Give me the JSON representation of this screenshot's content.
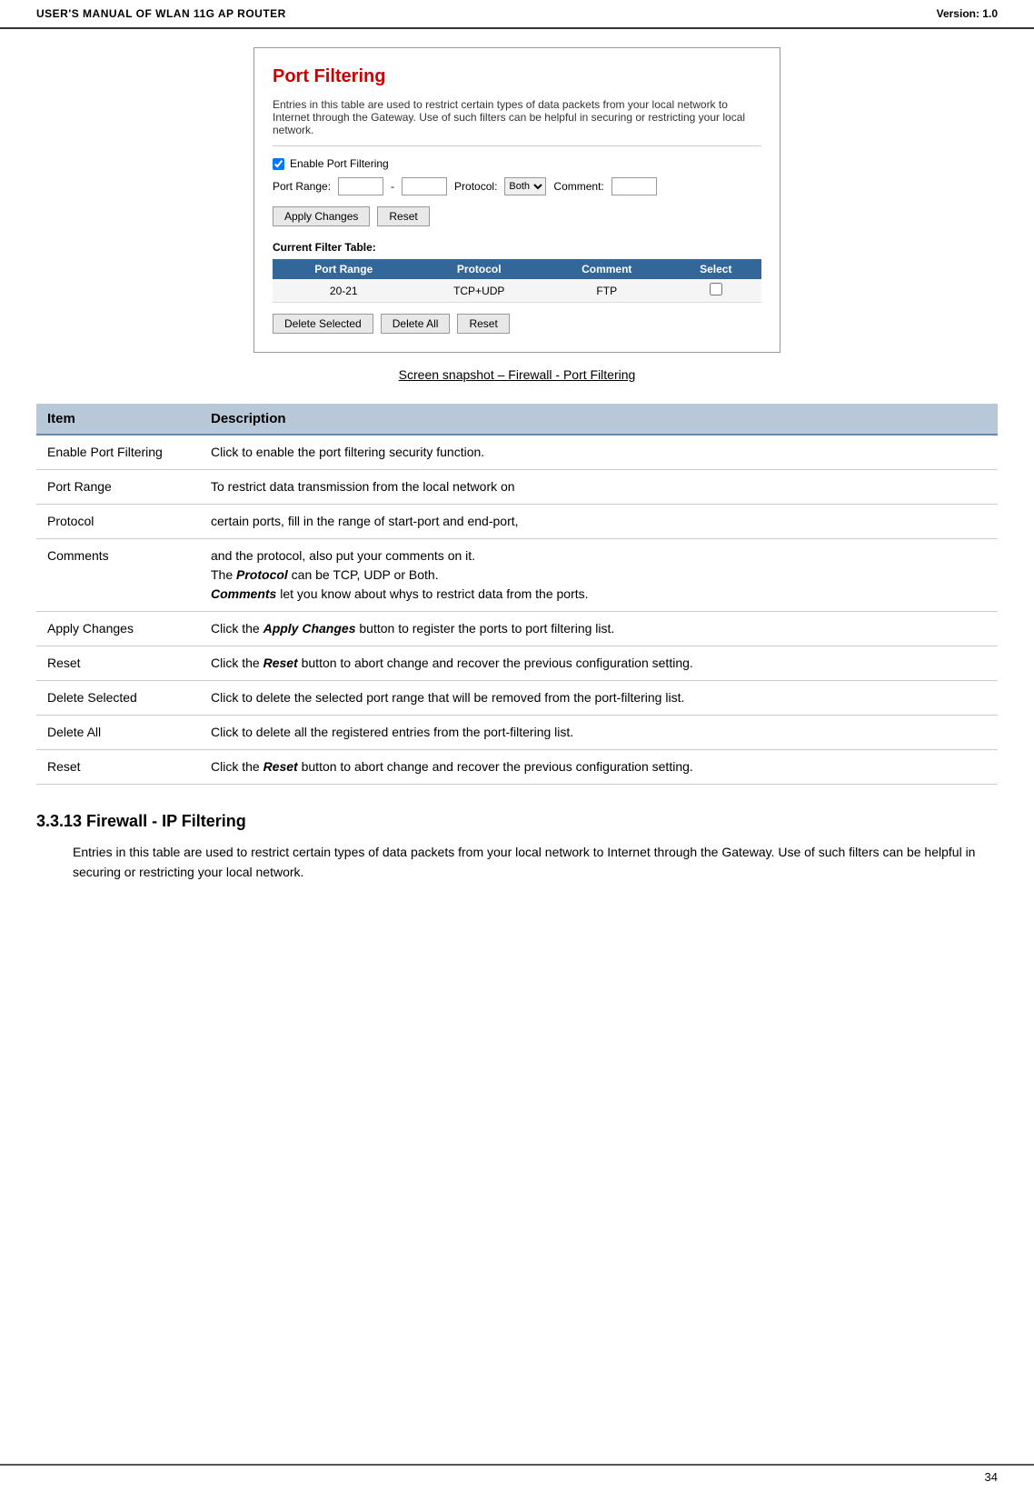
{
  "header": {
    "manual_title": "USER'S MANUAL OF WLAN 11G AP ROUTER",
    "version": "Version: 1.0"
  },
  "screenshot": {
    "title": "Port Filtering",
    "description": "Entries in this table are used to restrict certain types of data packets from your local network to Internet through the Gateway. Use of such filters can be helpful in securing or restricting your local network.",
    "enable_label": "Enable Port Filtering",
    "port_range_label": "Port Range:",
    "port_range_sep": "-",
    "protocol_label": "Protocol:",
    "protocol_value": "Both",
    "comment_label": "Comment:",
    "apply_btn": "Apply Changes",
    "reset_btn": "Reset",
    "current_filter_label": "Current Filter Table:",
    "table_headers": [
      "Port Range",
      "Protocol",
      "Comment",
      "Select"
    ],
    "table_rows": [
      {
        "port_range": "20-21",
        "protocol": "TCP+UDP",
        "comment": "FTP"
      }
    ],
    "delete_selected_btn": "Delete Selected",
    "delete_all_btn": "Delete All",
    "bottom_reset_btn": "Reset"
  },
  "caption": "Screen snapshot – Firewall - Port Filtering",
  "desc_table": {
    "col_item": "Item",
    "col_description": "Description",
    "rows": [
      {
        "item": "Enable Port Filtering",
        "description": "Click to enable the port filtering security function."
      },
      {
        "item": "Port Range",
        "description": "To restrict data transmission from the local network on"
      },
      {
        "item": "Protocol",
        "description": "certain ports, fill in the range of start-port and end-port,"
      },
      {
        "item": "Comments",
        "description_parts": [
          {
            "text": "and the protocol, also put your comments on it.",
            "bold_italic": false
          },
          {
            "text": "The ",
            "bold_italic": false
          },
          {
            "text": "Protocol",
            "bold_italic": true
          },
          {
            "text": " can be TCP, UDP or Both.",
            "bold_italic": false
          }
        ],
        "description_line2_parts": [
          {
            "text": "Comments",
            "bold_italic": true
          },
          {
            "text": " let you know about whys to restrict data from the ports.",
            "bold_italic": false
          }
        ]
      },
      {
        "item": "Apply Changes",
        "description_parts": [
          {
            "text": "Click the ",
            "bold_italic": false
          },
          {
            "text": "Apply Changes",
            "bold_italic": true
          },
          {
            "text": " button to register the ports to port filtering list.",
            "bold_italic": false
          }
        ]
      },
      {
        "item": "Reset",
        "description_parts": [
          {
            "text": "Click the ",
            "bold_italic": false
          },
          {
            "text": "Reset",
            "bold_italic": true
          },
          {
            "text": " button to abort change and recover the previous configuration setting.",
            "bold_italic": false
          }
        ]
      },
      {
        "item": "Delete Selected",
        "description": "Click to delete the selected port range that will be removed from the port-filtering list."
      },
      {
        "item": "Delete All",
        "description": "Click to delete all the registered entries from the port-filtering list."
      },
      {
        "item": "Reset",
        "description_parts": [
          {
            "text": "Click the ",
            "bold_italic": false
          },
          {
            "text": "Reset",
            "bold_italic": true
          },
          {
            "text": " button to abort change and recover the previous configuration setting.",
            "bold_italic": false
          }
        ]
      }
    ]
  },
  "section": {
    "heading": "3.3.13  Firewall - IP Filtering",
    "body": "Entries in this table are used to restrict certain types of data packets from your local network to Internet through the Gateway. Use of such filters can be helpful in securing or restricting your local network."
  },
  "footer": {
    "page_number": "34"
  }
}
